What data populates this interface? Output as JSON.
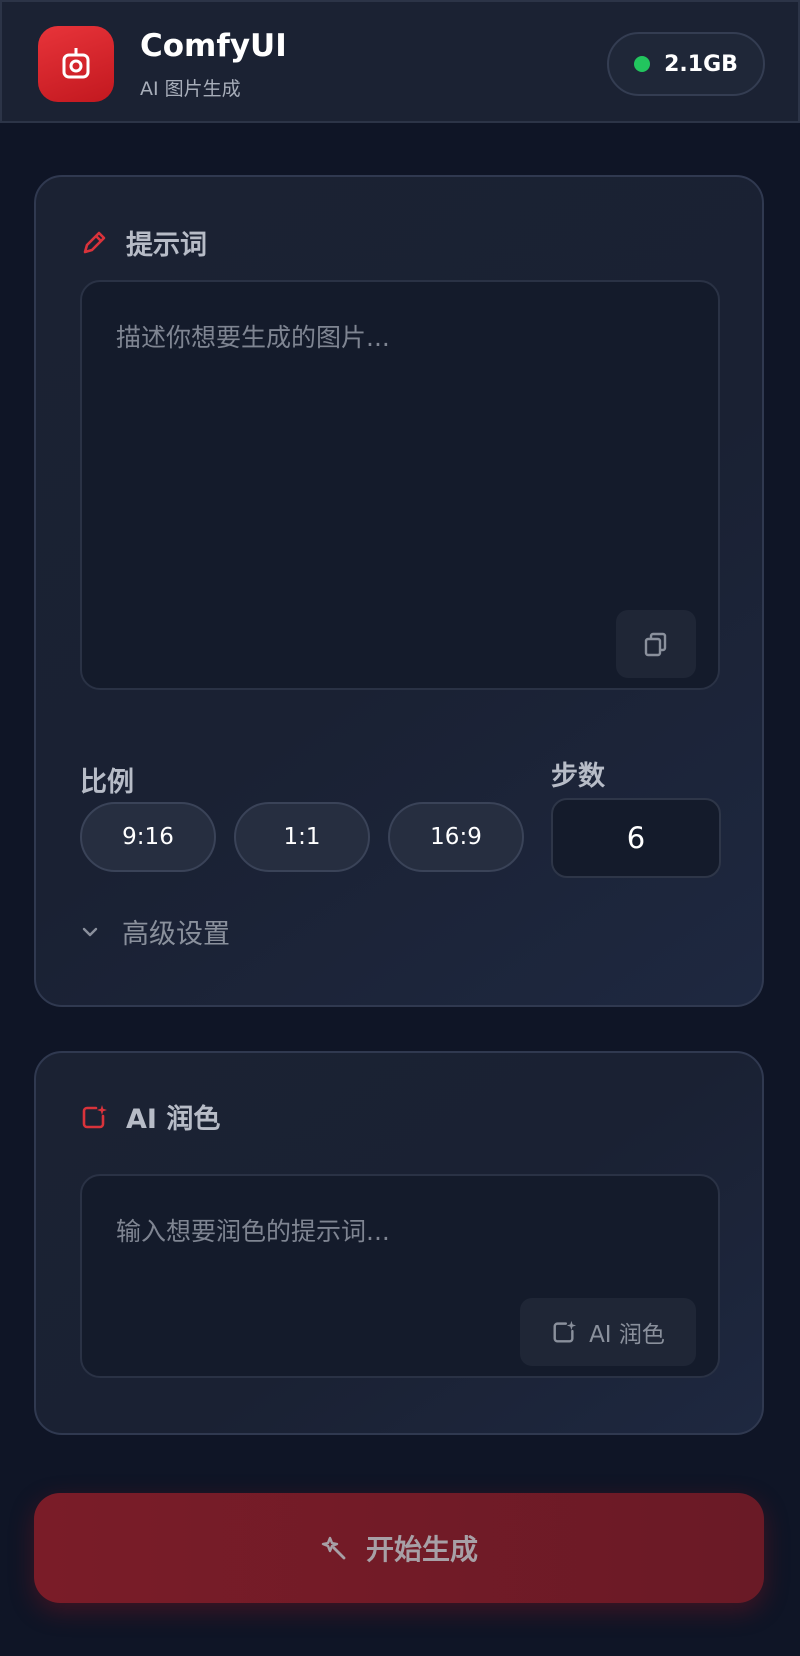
{
  "header": {
    "title": "ComfyUI",
    "subtitle": "AI 图片生成",
    "memory": "2.1GB",
    "status_color": "#22c55e"
  },
  "prompt_card": {
    "title": "提示词",
    "placeholder": "描述你想要生成的图片...",
    "ratio_label": "比例",
    "ratios": [
      "9:16",
      "1:1",
      "16:9"
    ],
    "steps_label": "步数",
    "steps_value": "6",
    "advanced_label": "高级设置"
  },
  "polish_card": {
    "title": "AI 润色",
    "placeholder": "输入想要润色的提示词...",
    "button_label": "AI 润色"
  },
  "generate": {
    "label": "开始生成"
  },
  "colors": {
    "accent": "#e8343a",
    "background": "#0f1526",
    "card": "#1b2233"
  },
  "icons": {
    "logo": "robot-camera-icon",
    "prompt": "pencil-icon",
    "copy": "copy-icon",
    "advanced": "chevron-down-icon",
    "polish": "sparkle-square-icon",
    "generate": "magic-wand-icon"
  }
}
